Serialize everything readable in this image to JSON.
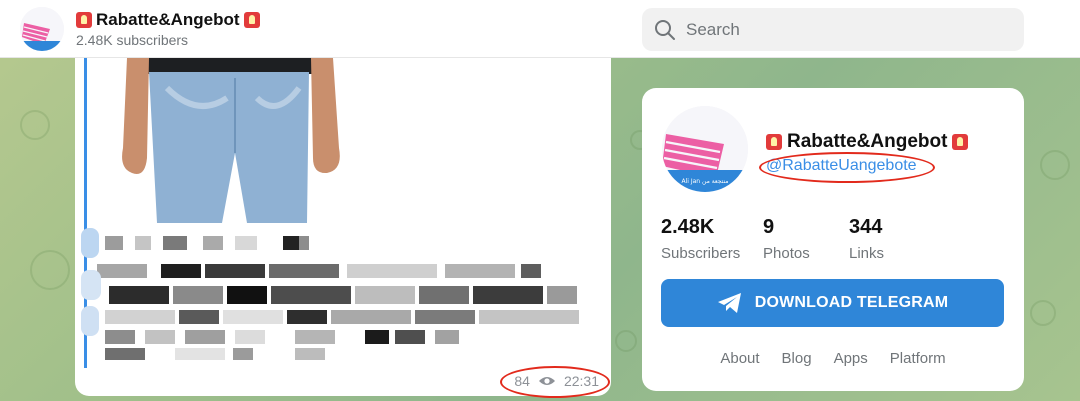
{
  "header": {
    "channel_name": "Rabatte&Angebot",
    "subscribers": "2.48K subscribers"
  },
  "search": {
    "placeholder": "Search"
  },
  "message": {
    "views": "84",
    "time": "22:31"
  },
  "channel_info": {
    "name": "Rabatte&Angebot",
    "handle": "@RabatteUangebote",
    "avatar_text": "Ali Jan منتجعة من",
    "stats": [
      {
        "value": "2.48K",
        "label": "Subscribers"
      },
      {
        "value": "9",
        "label": "Photos"
      },
      {
        "value": "344",
        "label": "Links"
      }
    ],
    "download_button": "DOWNLOAD TELEGRAM",
    "footer_links": [
      "About",
      "Blog",
      "Apps",
      "Platform"
    ]
  },
  "colors": {
    "accent_blue": "#2f86d8",
    "highlight_red": "#e22a1c",
    "siren_red": "#e23b3b"
  }
}
